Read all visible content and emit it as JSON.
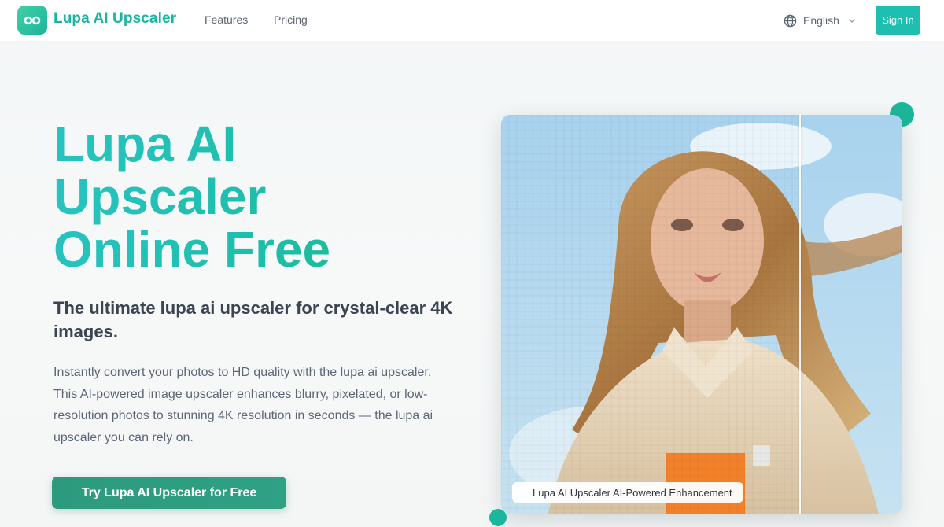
{
  "header": {
    "brand": "Lupa AI Upscaler",
    "nav": [
      {
        "label": "Features"
      },
      {
        "label": "Pricing"
      }
    ],
    "language": "English",
    "sign_in": "Sign In"
  },
  "hero": {
    "title_lines": [
      "Lupa AI",
      "Upscaler",
      "Online Free"
    ],
    "subtitle": "The ultimate lupa ai upscaler for crystal-clear 4K images.",
    "description": "Instantly convert your photos to HD quality with the lupa ai upscaler. This AI-powered image upscaler enhances blurry, pixelated, or low-resolution photos to stunning 4K resolution in seconds — the lupa ai upscaler you can rely on.",
    "cta": "Try Lupa AI Upscaler for Free"
  },
  "comparison": {
    "caption": "Lupa AI Upscaler AI-Powered Enhancement"
  },
  "colors": {
    "brand": "#18b5a3",
    "button": "#1dbfb0",
    "cta": "#2c9a7d",
    "title_gradient_start": "#29c3c2",
    "title_gradient_end": "#17b889"
  },
  "icons": {
    "logo": "infinity-icon",
    "language": "globe-icon",
    "dropdown": "chevron-down-icon"
  }
}
